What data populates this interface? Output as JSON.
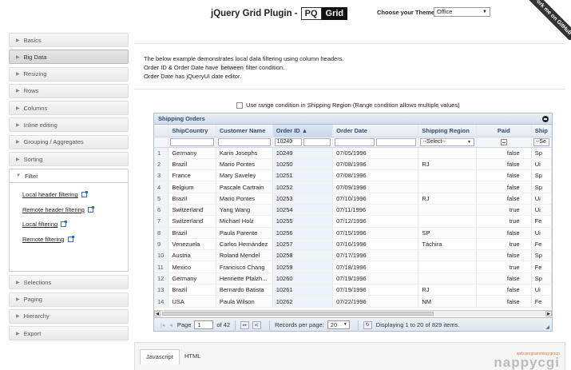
{
  "header": {
    "title": "jQuery Grid Plugin -",
    "pq": "PQ",
    "grid": "Grid",
    "theme_label": "Choose your Theme:",
    "theme_value": "Office",
    "ribbon": "Fork me on GitHub"
  },
  "sidebar": {
    "items_top": [
      "Basics",
      "Big Data",
      "Resizing",
      "Rows",
      "Columns",
      "Inline editing",
      "Grouping / Aggregates",
      "Sorting"
    ],
    "open_item": "Filter",
    "sub_links": [
      "Local header filtering",
      "Remote header filtering",
      "Local filtering",
      "Remote filtering"
    ],
    "items_bottom": [
      "Selections",
      "Paging",
      "Hierarchy",
      "Export"
    ]
  },
  "description": {
    "line1": "The below example demonstrates local data filtering using column headers.",
    "line2_pre": "Order ID & Order Date have",
    "line2_hl": "between",
    "line2_post": "filter condition.",
    "line3": "Order Date has jQueryUI date editor."
  },
  "range_option": "Use range condition in Shipping Region (Range condition allows multiple values)",
  "grid": {
    "title": "Shipping Orders",
    "columns": [
      "ShipCountry",
      "Customer Name",
      "Order ID ▲",
      "Order Date",
      "Shipping Region",
      "Paid",
      "Ship"
    ],
    "filters": {
      "order_id": "10249",
      "region_select": "--Select--",
      "ship_select": "--Se"
    },
    "rows": [
      {
        "n": "1",
        "country": "Germany",
        "customer": "Karin Josephs",
        "id": "10249",
        "date": "07/05/1996",
        "region": "",
        "paid": "false",
        "ship": "Sp"
      },
      {
        "n": "2",
        "country": "Brazil",
        "customer": "Mario Pontes",
        "id": "10250",
        "date": "07/08/1996",
        "region": "RJ",
        "paid": "false",
        "ship": "Ui"
      },
      {
        "n": "3",
        "country": "France",
        "customer": "Mary Saveley",
        "id": "10251",
        "date": "07/08/1996",
        "region": "",
        "paid": "false",
        "ship": "Sp"
      },
      {
        "n": "4",
        "country": "Belgium",
        "customer": "Pascale Cartrain",
        "id": "10252",
        "date": "07/09/1996",
        "region": "",
        "paid": "false",
        "ship": "Sp"
      },
      {
        "n": "5",
        "country": "Brazil",
        "customer": "Mario Pontes",
        "id": "10253",
        "date": "07/10/1996",
        "region": "RJ",
        "paid": "false",
        "ship": "Ui"
      },
      {
        "n": "6",
        "country": "Switzerland",
        "customer": "Yang Wang",
        "id": "10254",
        "date": "07/11/1996",
        "region": "",
        "paid": "true",
        "ship": "Ui"
      },
      {
        "n": "7",
        "country": "Switzerland",
        "customer": "Michael Holz",
        "id": "10255",
        "date": "07/12/1996",
        "region": "",
        "paid": "true",
        "ship": "Fe"
      },
      {
        "n": "8",
        "country": "Brazil",
        "customer": "Paula Parente",
        "id": "10256",
        "date": "07/15/1996",
        "region": "SP",
        "paid": "false",
        "ship": "Ui"
      },
      {
        "n": "9",
        "country": "Venezuela",
        "customer": "Carlos Hernández",
        "id": "10257",
        "date": "07/16/1996",
        "region": "Táchira",
        "paid": "true",
        "ship": "Fe"
      },
      {
        "n": "10",
        "country": "Austria",
        "customer": "Roland Mendel",
        "id": "10258",
        "date": "07/17/1996",
        "region": "",
        "paid": "false",
        "ship": "Sp"
      },
      {
        "n": "11",
        "country": "Mexico",
        "customer": "Francisco Chang",
        "id": "10259",
        "date": "07/18/1996",
        "region": "",
        "paid": "true",
        "ship": "Fe"
      },
      {
        "n": "12",
        "country": "Germany",
        "customer": "Henriette Pfalzh...",
        "id": "10260",
        "date": "07/19/1996",
        "region": "",
        "paid": "false",
        "ship": "Sp"
      },
      {
        "n": "13",
        "country": "Brazil",
        "customer": "Bernardo Batista",
        "id": "10261",
        "date": "07/19/1996",
        "region": "RJ",
        "paid": "false",
        "ship": "Ui"
      },
      {
        "n": "14",
        "country": "USA",
        "customer": "Paula Wilson",
        "id": "10262",
        "date": "07/22/1996",
        "region": "NM",
        "paid": "false",
        "ship": "Fe"
      }
    ]
  },
  "pager": {
    "page_label": "Page",
    "page_value": "1",
    "of_label": "of 42",
    "records_label": "Records per page:",
    "records_value": "20",
    "display_text": "Displaying 1 to 20 of 829 items."
  },
  "code_tabs": [
    "Javascript",
    "HTML"
  ],
  "watermark": {
    "small": "web programming group",
    "big": "nappycgi"
  }
}
